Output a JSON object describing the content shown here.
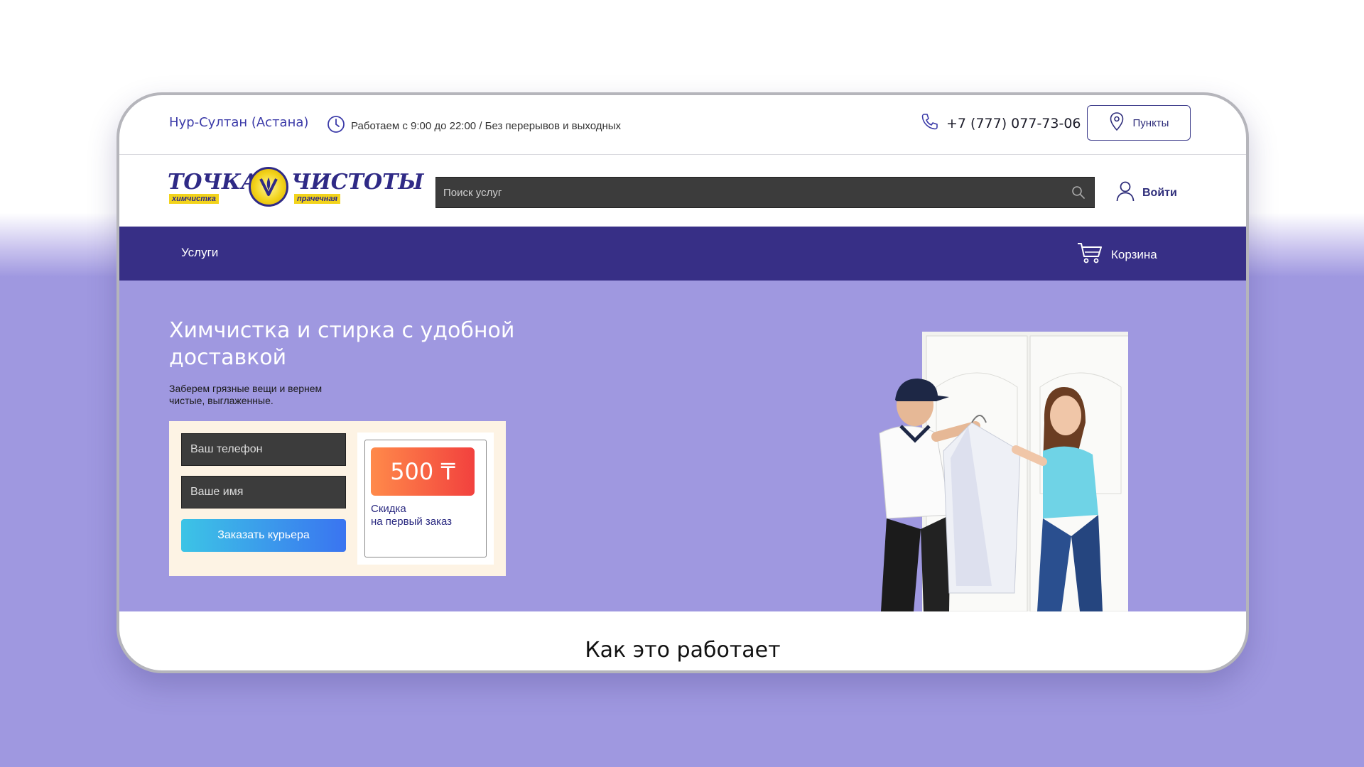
{
  "topbar": {
    "city": "Нур-Султан (Астана)",
    "hours": "Работаем с 9:00 до 22:00 / Без перерывов и выходных",
    "phone": "+7 (777) 077-73-06",
    "points_label": "Пункты"
  },
  "header": {
    "logo": {
      "word1": "ТОЧКА",
      "word2": "ЧИСТОТЫ",
      "tag1": "химчистка",
      "tag2": "прачечная"
    },
    "search_placeholder": "Поиск услуг",
    "login_label": "Войти"
  },
  "nav": {
    "services_label": "Услуги",
    "cart_label": "Корзина"
  },
  "hero": {
    "title": "Химчистка и стирка с удобной доставкой",
    "subtitle": "Заберем грязные вещи и вернем чистые, выглаженные.",
    "phone_placeholder": "Ваш телефон",
    "name_placeholder": "Ваше имя",
    "order_button": "Заказать курьера",
    "promo_amount": "500 ₸",
    "promo_text_line1": "Скидка",
    "promo_text_line2": "на первый заказ"
  },
  "section": {
    "how_it_works": "Как это работает"
  },
  "colors": {
    "brand": "#372f86",
    "accent": "#9f98e0",
    "promo": "#f2413e"
  }
}
